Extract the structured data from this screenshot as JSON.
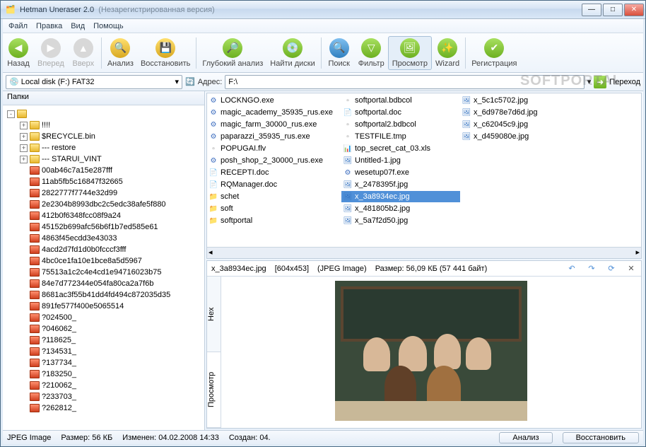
{
  "window": {
    "title": "Hetman Uneraser 2.0",
    "subtitle": "(Незарегистрированная версия)"
  },
  "menu": {
    "file": "Файл",
    "edit": "Правка",
    "view": "Вид",
    "help": "Помощь"
  },
  "toolbar": {
    "back": "Назад",
    "forward": "Вперед",
    "up": "Вверх",
    "analyze": "Анализ",
    "recover": "Восстановить",
    "deep": "Глубокий анализ",
    "find": "Найти диски",
    "search": "Поиск",
    "filter": "Фильтр",
    "preview": "Просмотр",
    "wizard": "Wizard",
    "register": "Регистрация"
  },
  "watermark": "SOFTPORTAL",
  "addressbar": {
    "drive": "Local disk (F:) FAT32",
    "addr_label": "Адрес:",
    "addr_value": "F:\\",
    "go": "Переход"
  },
  "tree": {
    "header": "Папки",
    "root_children": [
      {
        "name": "!!!!",
        "exp": "+",
        "del": false
      },
      {
        "name": "$RECYCLE.bin",
        "exp": "+",
        "del": false
      },
      {
        "name": "--- restore",
        "exp": "+",
        "del": false
      },
      {
        "name": "--- STARUI_VINT",
        "exp": "+",
        "del": false
      },
      {
        "name": "00ab46c7a15e287fff",
        "exp": "",
        "del": true
      },
      {
        "name": "11ab5fb5c16847f32665",
        "exp": "",
        "del": true
      },
      {
        "name": "2822777f7744e32d99",
        "exp": "",
        "del": true
      },
      {
        "name": "2e2304b8993dbc2c5edc38afe5f880",
        "exp": "",
        "del": true
      },
      {
        "name": "412b0f6348fcc08f9a24",
        "exp": "",
        "del": true
      },
      {
        "name": "45152b699afc56b6f1b7ed585e61",
        "exp": "",
        "del": true
      },
      {
        "name": "4863f45ecdd3e43033",
        "exp": "",
        "del": true
      },
      {
        "name": "4acd2d7fd1d0b0fcccf3fff",
        "exp": "",
        "del": true
      },
      {
        "name": "4bc0ce1fa10e1bce8a5d5967",
        "exp": "",
        "del": true
      },
      {
        "name": "75513a1c2c4e4cd1e94716023b75",
        "exp": "",
        "del": true
      },
      {
        "name": "84e7d772344e054fa80ca2a7f6b",
        "exp": "",
        "del": true
      },
      {
        "name": "8681ac3f55b41dd4fd494c872035d35",
        "exp": "",
        "del": true
      },
      {
        "name": "891fe577f400e5065514",
        "exp": "",
        "del": true
      },
      {
        "name": "?024500_",
        "exp": "",
        "del": true
      },
      {
        "name": "?046062_",
        "exp": "",
        "del": true
      },
      {
        "name": "?118625_",
        "exp": "",
        "del": true
      },
      {
        "name": "?134531_",
        "exp": "",
        "del": true
      },
      {
        "name": "?137734_",
        "exp": "",
        "del": true
      },
      {
        "name": "?183250_",
        "exp": "",
        "del": true
      },
      {
        "name": "?210062_",
        "exp": "",
        "del": true
      },
      {
        "name": "?233703_",
        "exp": "",
        "del": true
      },
      {
        "name": "?262812_",
        "exp": "",
        "del": true
      }
    ]
  },
  "files": {
    "col1": [
      {
        "n": "LOCKNGO.exe",
        "t": "exe"
      },
      {
        "n": "magic_academy_35935_rus.exe",
        "t": "exe"
      },
      {
        "n": "magic_farm_30000_rus.exe",
        "t": "exe"
      },
      {
        "n": "paparazzi_35935_rus.exe",
        "t": "exe"
      },
      {
        "n": "POPUGAI.flv",
        "t": "tmp"
      },
      {
        "n": "posh_shop_2_30000_rus.exe",
        "t": "exe"
      },
      {
        "n": "RECEPTI.doc",
        "t": "doc"
      },
      {
        "n": "RQManager.doc",
        "t": "doc"
      },
      {
        "n": "schet",
        "t": "fld"
      },
      {
        "n": "soft",
        "t": "fld"
      },
      {
        "n": "softportal",
        "t": "fld"
      }
    ],
    "col2": [
      {
        "n": "softportal.bdbcol",
        "t": "tmp"
      },
      {
        "n": "softportal.doc",
        "t": "doc"
      },
      {
        "n": "softportal2.bdbcol",
        "t": "tmp"
      },
      {
        "n": "TESTFILE.tmp",
        "t": "tmp"
      },
      {
        "n": "top_secret_cat_03.xls",
        "t": "xls"
      },
      {
        "n": "Untitled-1.jpg",
        "t": "img"
      },
      {
        "n": "wesetup07f.exe",
        "t": "exe"
      },
      {
        "n": "x_2478395f.jpg",
        "t": "img"
      },
      {
        "n": "x_3a8934ec.jpg",
        "t": "img",
        "sel": true
      },
      {
        "n": "x_481805b2.jpg",
        "t": "img"
      },
      {
        "n": "x_5a7f2d50.jpg",
        "t": "img"
      }
    ],
    "col3": [
      {
        "n": "x_5c1c5702.jpg",
        "t": "img"
      },
      {
        "n": "x_6d978e7d6d.jpg",
        "t": "img"
      },
      {
        "n": "x_c62045c9.jpg",
        "t": "img"
      },
      {
        "n": "x_d459080e.jpg",
        "t": "img"
      }
    ]
  },
  "preview": {
    "name": "x_3a8934ec.jpg",
    "dims": "[604x453]",
    "type": "(JPEG Image)",
    "size_label": "Размер: 56,09 КБ (57 441 байт)",
    "tab_view": "Просмотр",
    "tab_hex": "Hex"
  },
  "status": {
    "type": "JPEG Image",
    "size": "Размер: 56 КБ",
    "modified": "Изменен: 04.02.2008 14:33",
    "created": "Создан: 04.",
    "analyze": "Анализ",
    "recover": "Восстановить"
  }
}
